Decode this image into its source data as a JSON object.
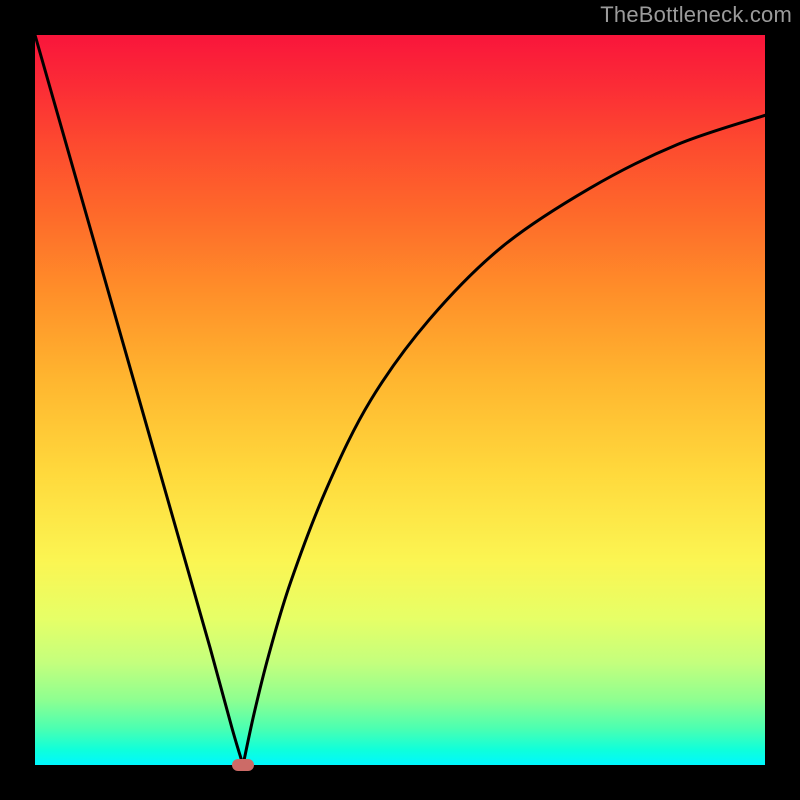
{
  "watermark": "TheBottleneck.com",
  "chart_data": {
    "type": "line",
    "title": "",
    "xlabel": "",
    "ylabel": "",
    "xlim": [
      0,
      100
    ],
    "ylim": [
      0,
      100
    ],
    "grid": false,
    "legend": false,
    "series": [
      {
        "name": "left-branch",
        "x": [
          0,
          4,
          8,
          12,
          16,
          20,
          24,
          27,
          28.5
        ],
        "y": [
          100,
          86,
          72,
          58,
          44,
          30,
          16,
          5,
          0
        ]
      },
      {
        "name": "right-branch",
        "x": [
          28.5,
          30,
          32,
          35,
          40,
          46,
          54,
          64,
          76,
          88,
          100
        ],
        "y": [
          0,
          7,
          15,
          25,
          38,
          50,
          61,
          71,
          79,
          85,
          89
        ]
      }
    ],
    "marker": {
      "x": 28.5,
      "y": 0,
      "color": "#cc6b67"
    },
    "background_gradient": {
      "top": "#f9153b",
      "mid": "#ffd93c",
      "bottom": "#00f8ff"
    },
    "line_color": "#000000"
  }
}
